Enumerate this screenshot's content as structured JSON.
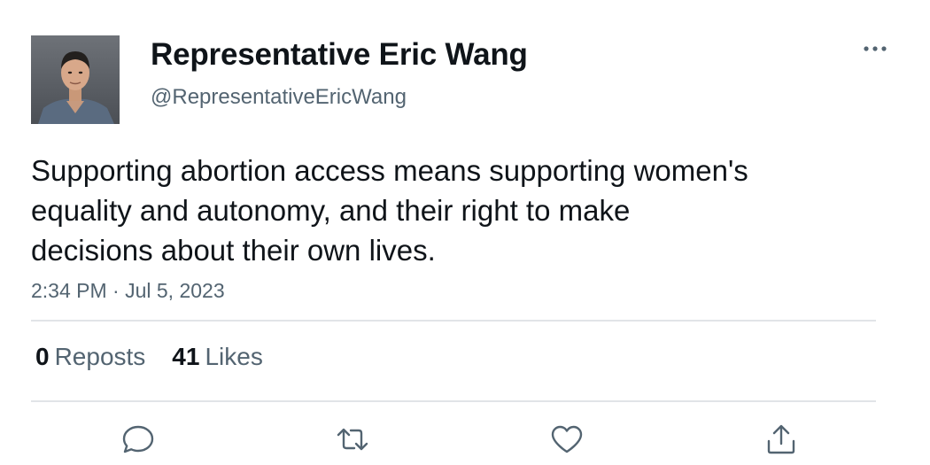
{
  "author": {
    "display_name": "Representative Eric Wang",
    "handle": "@RepresentativeEricWang"
  },
  "tweet": {
    "text": "Supporting abortion access means supporting women's\nequality and autonomy, and their right to make\ndecisions about their own lives.",
    "timestamp": "2:34 PM · Jul 5, 2023"
  },
  "stats": {
    "reposts_count": "0",
    "reposts_label": "Reposts",
    "likes_count": "41",
    "likes_label": "Likes"
  },
  "icons": {
    "more": "more-horizontal-icon",
    "reply": "reply-icon",
    "repost": "repost-icon",
    "like": "heart-icon",
    "share": "share-icon"
  },
  "colors": {
    "text_primary": "#0f1419",
    "text_secondary": "#536471",
    "divider": "#e1e4e8"
  }
}
